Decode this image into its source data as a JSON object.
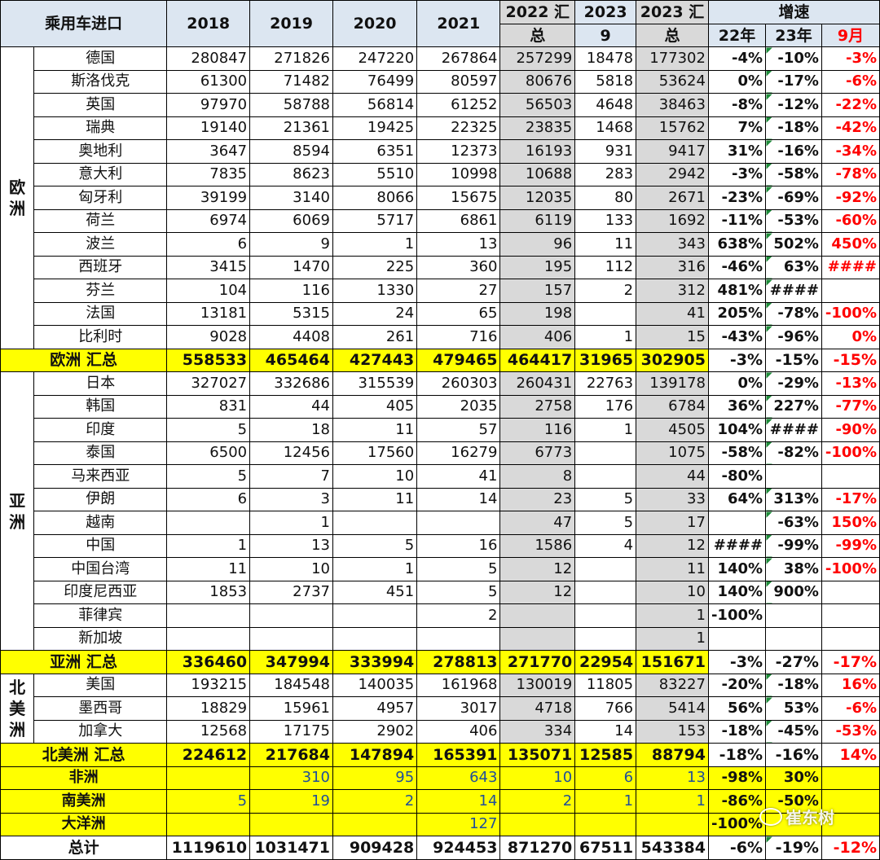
{
  "header": {
    "title": "乘用车进口",
    "years": [
      "2018",
      "2019",
      "2020",
      "2021"
    ],
    "sum2022_top": "2022 汇",
    "sum2022_bottom": "总",
    "sep2023_top": "2023",
    "sep2023_bottom": "9",
    "sum2023_top": "2023 汇",
    "sum2023_bottom": "总",
    "growth": "增速",
    "g22": "22年",
    "g23": "23年",
    "gsep": "9月"
  },
  "regions": {
    "europe": "欧洲",
    "asia": "亚洲",
    "north_america": "北美洲"
  },
  "rows": [
    {
      "name": "德国",
      "v": [
        "280847",
        "271826",
        "247220",
        "267864",
        "257299",
        "18478",
        "177302"
      ],
      "g": [
        "-4%",
        "-10%",
        "-3%"
      ]
    },
    {
      "name": "斯洛伐克",
      "v": [
        "61300",
        "71482",
        "76499",
        "80597",
        "80676",
        "5818",
        "53624"
      ],
      "g": [
        "0%",
        "-17%",
        "-6%"
      ]
    },
    {
      "name": "英国",
      "v": [
        "97970",
        "58788",
        "56814",
        "61252",
        "56503",
        "4648",
        "38463"
      ],
      "g": [
        "-8%",
        "-12%",
        "-22%"
      ]
    },
    {
      "name": "瑞典",
      "v": [
        "19140",
        "21361",
        "19425",
        "22325",
        "23835",
        "1468",
        "15762"
      ],
      "g": [
        "7%",
        "-18%",
        "-42%"
      ]
    },
    {
      "name": "奥地利",
      "v": [
        "3647",
        "8594",
        "6351",
        "12373",
        "16193",
        "931",
        "9417"
      ],
      "g": [
        "31%",
        "-16%",
        "-34%"
      ]
    },
    {
      "name": "意大利",
      "v": [
        "7835",
        "8623",
        "5510",
        "10998",
        "10688",
        "283",
        "2942"
      ],
      "g": [
        "-3%",
        "-58%",
        "-78%"
      ]
    },
    {
      "name": "匈牙利",
      "v": [
        "39199",
        "3140",
        "8066",
        "15675",
        "12035",
        "80",
        "2671"
      ],
      "g": [
        "-23%",
        "-69%",
        "-92%"
      ]
    },
    {
      "name": "荷兰",
      "v": [
        "6974",
        "6069",
        "5717",
        "6861",
        "6119",
        "133",
        "1692"
      ],
      "g": [
        "-11%",
        "-53%",
        "-60%"
      ]
    },
    {
      "name": "波兰",
      "v": [
        "6",
        "9",
        "1",
        "13",
        "96",
        "11",
        "343"
      ],
      "g": [
        "638%",
        "502%",
        "450%"
      ]
    },
    {
      "name": "西班牙",
      "v": [
        "3415",
        "1470",
        "225",
        "360",
        "195",
        "112",
        "316"
      ],
      "g": [
        "-46%",
        "63%",
        "####"
      ]
    },
    {
      "name": "芬兰",
      "v": [
        "104",
        "116",
        "1330",
        "27",
        "157",
        "2",
        "312"
      ],
      "g": [
        "481%",
        "####",
        ""
      ]
    },
    {
      "name": "法国",
      "v": [
        "13181",
        "5315",
        "24",
        "65",
        "198",
        "",
        "41"
      ],
      "g": [
        "205%",
        "-78%",
        "-100%"
      ]
    },
    {
      "name": "比利时",
      "v": [
        "9028",
        "4408",
        "261",
        "716",
        "406",
        "1",
        "15"
      ],
      "g": [
        "-43%",
        "-96%",
        "0%"
      ]
    },
    {
      "name": "欧洲 汇总",
      "v": [
        "558533",
        "465464",
        "427443",
        "479465",
        "464417",
        "31965",
        "302905"
      ],
      "g": [
        "-3%",
        "-15%",
        "-15%"
      ]
    },
    {
      "name": "日本",
      "v": [
        "327027",
        "332686",
        "315539",
        "260303",
        "260431",
        "22763",
        "139178"
      ],
      "g": [
        "0%",
        "-29%",
        "-13%"
      ]
    },
    {
      "name": "韩国",
      "v": [
        "831",
        "44",
        "405",
        "2035",
        "2758",
        "176",
        "6784"
      ],
      "g": [
        "36%",
        "227%",
        "-77%"
      ]
    },
    {
      "name": "印度",
      "v": [
        "5",
        "18",
        "11",
        "57",
        "116",
        "1",
        "4505"
      ],
      "g": [
        "104%",
        "####",
        "-90%"
      ]
    },
    {
      "name": "泰国",
      "v": [
        "6500",
        "12456",
        "17560",
        "16279",
        "6773",
        "",
        "1075"
      ],
      "g": [
        "-58%",
        "-82%",
        "-100%"
      ]
    },
    {
      "name": "马来西亚",
      "v": [
        "5",
        "7",
        "10",
        "41",
        "8",
        "",
        "44"
      ],
      "g": [
        "-80%",
        "",
        ""
      ]
    },
    {
      "name": "伊朗",
      "v": [
        "6",
        "3",
        "11",
        "14",
        "23",
        "5",
        "33"
      ],
      "g": [
        "64%",
        "313%",
        "-17%"
      ]
    },
    {
      "name": "越南",
      "v": [
        "",
        "1",
        "",
        "",
        "47",
        "5",
        "17"
      ],
      "g": [
        "",
        "-63%",
        "150%"
      ]
    },
    {
      "name": "中国",
      "v": [
        "1",
        "13",
        "5",
        "16",
        "1586",
        "4",
        "12"
      ],
      "g": [
        "####",
        "-99%",
        "-99%"
      ]
    },
    {
      "name": "中国台湾",
      "v": [
        "11",
        "10",
        "1",
        "5",
        "12",
        "",
        "11"
      ],
      "g": [
        "140%",
        "38%",
        "-100%"
      ]
    },
    {
      "name": "印度尼西亚",
      "v": [
        "1853",
        "2737",
        "451",
        "5",
        "12",
        "",
        "10"
      ],
      "g": [
        "140%",
        "900%",
        ""
      ]
    },
    {
      "name": "菲律宾",
      "v": [
        "",
        "",
        "",
        "2",
        "",
        "",
        "1"
      ],
      "g": [
        "-100%",
        "",
        ""
      ]
    },
    {
      "name": "新加坡",
      "v": [
        "",
        "",
        "",
        "",
        "",
        "",
        "1"
      ],
      "g": [
        "",
        "",
        ""
      ]
    },
    {
      "name": "亚洲 汇总",
      "v": [
        "336460",
        "347994",
        "333994",
        "278813",
        "271770",
        "22954",
        "151671"
      ],
      "g": [
        "-3%",
        "-27%",
        "-17%"
      ]
    },
    {
      "name": "美国",
      "v": [
        "193215",
        "184548",
        "140035",
        "161968",
        "130019",
        "11805",
        "83227"
      ],
      "g": [
        "-20%",
        "-18%",
        "16%"
      ]
    },
    {
      "name": "墨西哥",
      "v": [
        "18829",
        "15961",
        "4957",
        "3017",
        "4718",
        "766",
        "5414"
      ],
      "g": [
        "56%",
        "53%",
        "-6%"
      ]
    },
    {
      "name": "加拿大",
      "v": [
        "12568",
        "17175",
        "2902",
        "406",
        "334",
        "14",
        "153"
      ],
      "g": [
        "-18%",
        "-45%",
        "-53%"
      ]
    },
    {
      "name": "北美洲 汇总",
      "v": [
        "224612",
        "217684",
        "147894",
        "165391",
        "135071",
        "12585",
        "88794"
      ],
      "g": [
        "-18%",
        "-16%",
        "14%"
      ]
    },
    {
      "name": "非洲",
      "v": [
        "",
        "310",
        "95",
        "643",
        "10",
        "6",
        "13"
      ],
      "g": [
        "-98%",
        "30%",
        ""
      ]
    },
    {
      "name": "南美洲",
      "v": [
        "5",
        "19",
        "2",
        "14",
        "2",
        "1",
        "1"
      ],
      "g": [
        "-86%",
        "-50%",
        ""
      ]
    },
    {
      "name": "大洋洲",
      "v": [
        "",
        "",
        "",
        "127",
        "",
        "",
        ""
      ],
      "g": [
        "-100%",
        "",
        ""
      ]
    },
    {
      "name": "总计",
      "v": [
        "1119610",
        "1031471",
        "909428",
        "924453",
        "871270",
        "67511",
        "543384"
      ],
      "g": [
        "-6%",
        "-19%",
        "-12%"
      ]
    }
  ],
  "watermark": "崔东树"
}
